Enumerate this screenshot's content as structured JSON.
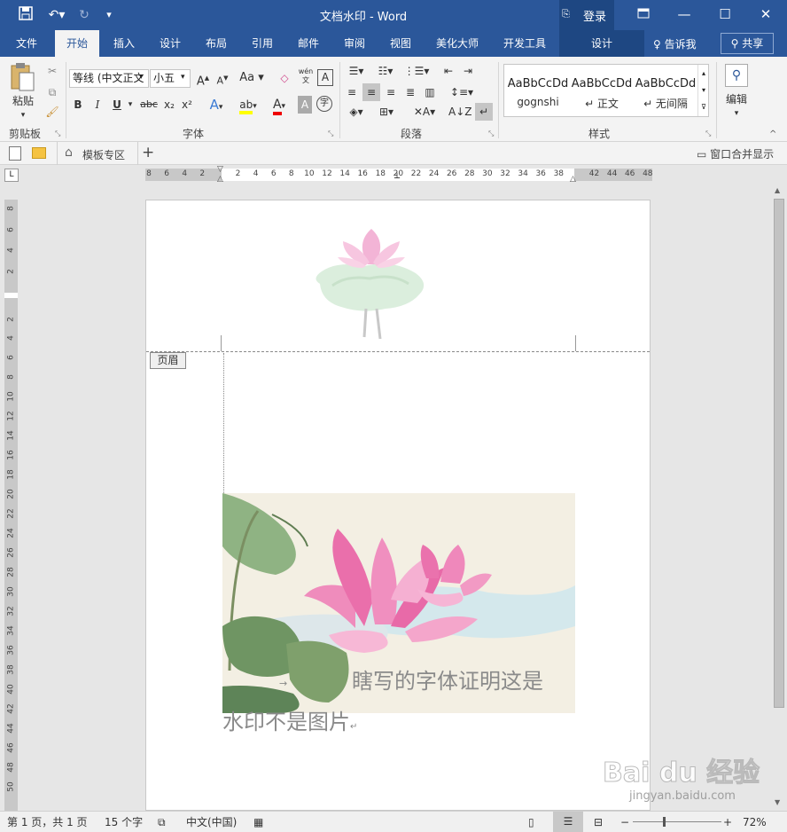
{
  "titlebar": {
    "title": "文档水印 - Word",
    "signin": "登录",
    "colors": {
      "bar": "#2b579a"
    }
  },
  "tabs": [
    {
      "label": "文件"
    },
    {
      "label": "开始"
    },
    {
      "label": "插入"
    },
    {
      "label": "设计"
    },
    {
      "label": "布局"
    },
    {
      "label": "引用"
    },
    {
      "label": "邮件"
    },
    {
      "label": "审阅"
    },
    {
      "label": "视图"
    },
    {
      "label": "美化大师"
    },
    {
      "label": "开发工具"
    }
  ],
  "context_tab": "设计",
  "tellme": "告诉我",
  "share": "共享",
  "ribbon": {
    "paste_label": "粘贴",
    "clipboard_label": "剪贴板",
    "font_label": "字体",
    "paragraph_label": "段落",
    "styles_label": "样式",
    "editing_label": "编辑",
    "font_name": "等线 (中文正文",
    "font_size": "小五",
    "aa_label": "Aa",
    "bold": "B",
    "italic": "I",
    "underline": "U",
    "strike": "abc",
    "sub": "x₂",
    "sup": "x²",
    "phonetic": "wén",
    "styles": [
      {
        "preview": "AaBbCcDd",
        "name": "gognshi"
      },
      {
        "preview": "AaBbCcDd",
        "name": "↵ 正文"
      },
      {
        "preview": "AaBbCcDd",
        "name": "↵ 无间隔"
      }
    ]
  },
  "docbar": {
    "template_tab": "模板专区",
    "merge": "窗口合并显示"
  },
  "ruler": {
    "h_labels": [
      "8",
      "6",
      "4",
      "2",
      "",
      "2",
      "4",
      "6",
      "8",
      "10",
      "12",
      "14",
      "16",
      "18",
      "20",
      "22",
      "24",
      "26",
      "28",
      "30",
      "32",
      "34",
      "36",
      "38",
      "",
      "42",
      "44",
      "46",
      "48"
    ],
    "v_labels": [
      "8",
      "6",
      "4",
      "2",
      "",
      "2",
      "4",
      "6",
      "8",
      "10",
      "12",
      "14",
      "16",
      "18",
      "20",
      "22",
      "24",
      "26",
      "28",
      "30",
      "32",
      "34",
      "36",
      "38",
      "40",
      "42",
      "44",
      "46",
      "48",
      "50"
    ]
  },
  "document": {
    "header_tag": "页眉",
    "text_line1": "瞎写的字体证明这是",
    "text_line2": "水印不是图片"
  },
  "status": {
    "page": "第 1 页，共 1 页",
    "words": "15 个字",
    "lang": "中文(中国)",
    "zoom": "72%"
  },
  "watermark": {
    "brand": "Bai du 经验",
    "url": "jingyan.baidu.com"
  }
}
